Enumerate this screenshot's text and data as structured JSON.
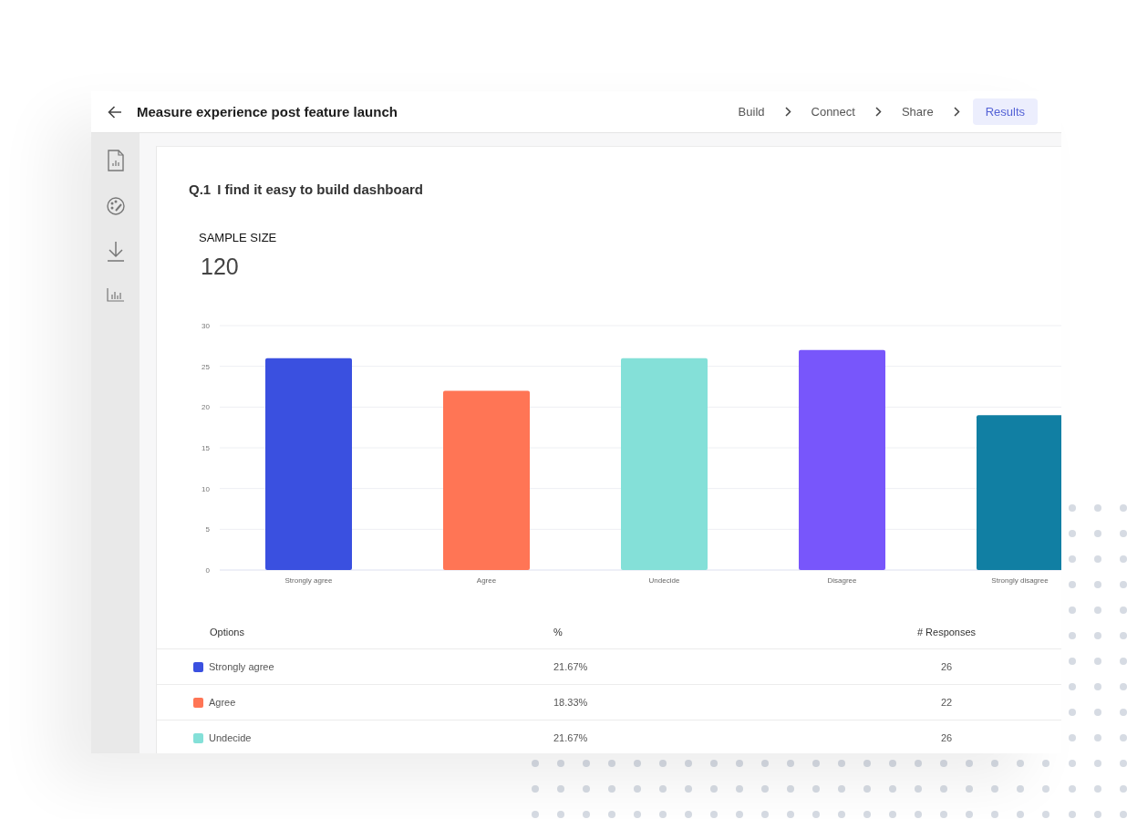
{
  "header": {
    "title": "Measure experience post feature launch",
    "steps": [
      {
        "label": "Build",
        "selected": false
      },
      {
        "label": "Connect",
        "selected": false
      },
      {
        "label": "Share",
        "selected": false
      },
      {
        "label": "Results",
        "selected": true
      }
    ]
  },
  "question": {
    "number": "Q.1",
    "text": "I find it easy to build dashboard"
  },
  "sample_size": {
    "label": "SAMPLE SIZE",
    "value": "120"
  },
  "chart_data": {
    "type": "bar",
    "categories": [
      "Strongly agree",
      "Agree",
      "Undecide",
      "Disagree",
      "Strongly disagree"
    ],
    "values": [
      26,
      22,
      26,
      27,
      19
    ],
    "grid": true,
    "colors": [
      "#3a50e0",
      "#ff7555",
      "#84e0d8",
      "#7856fb",
      "#117fa3"
    ],
    "ylim": [
      0,
      30
    ],
    "yticks": [
      0,
      5,
      10,
      15,
      20,
      25,
      30
    ]
  },
  "table": {
    "columns": [
      "Options",
      "%",
      "# Responses"
    ],
    "rows": [
      {
        "option": "Strongly agree",
        "color": "#3a50e0",
        "percent": "21.67%",
        "responses": "26"
      },
      {
        "option": "Agree",
        "color": "#ff7555",
        "percent": "18.33%",
        "responses": "22"
      },
      {
        "option": "Undecide",
        "color": "#84e0d8",
        "percent": "21.67%",
        "responses": "26"
      }
    ]
  }
}
